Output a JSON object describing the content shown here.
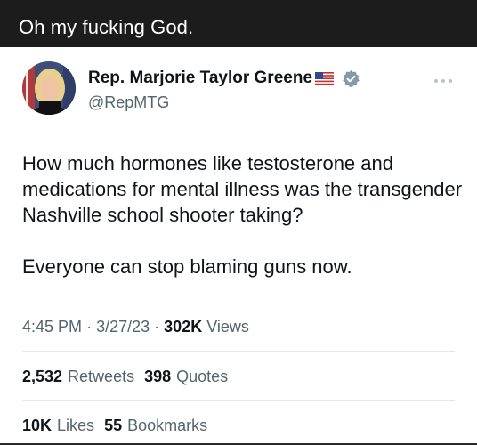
{
  "caption": "Oh my fucking God.",
  "tweet": {
    "author_name": "Rep. Marjorie Taylor Greene",
    "flag_icon": "us-flag-icon",
    "verified_icon": "verified-badge-icon",
    "handle": "@RepMTG",
    "paragraphs": [
      "How much hormones like testosterone and medications for mental illness was the transgender Nashville school shooter taking?",
      "Everyone can stop blaming guns now."
    ],
    "time": "4:45 PM",
    "date": "3/27/23",
    "separator": "·",
    "views_count": "302K",
    "views_label": "Views",
    "retweets_count": "2,532",
    "retweets_label": "Retweets",
    "quotes_count": "398",
    "quotes_label": "Quotes",
    "likes_count": "10K",
    "likes_label": "Likes",
    "bookmarks_count": "55",
    "bookmarks_label": "Bookmarks"
  },
  "colors": {
    "caption_bar": "#1c1c1c",
    "text_primary": "#0f1419",
    "text_secondary": "#536471",
    "verified_badge": "#829aab",
    "divider": "#e4e8eb"
  }
}
